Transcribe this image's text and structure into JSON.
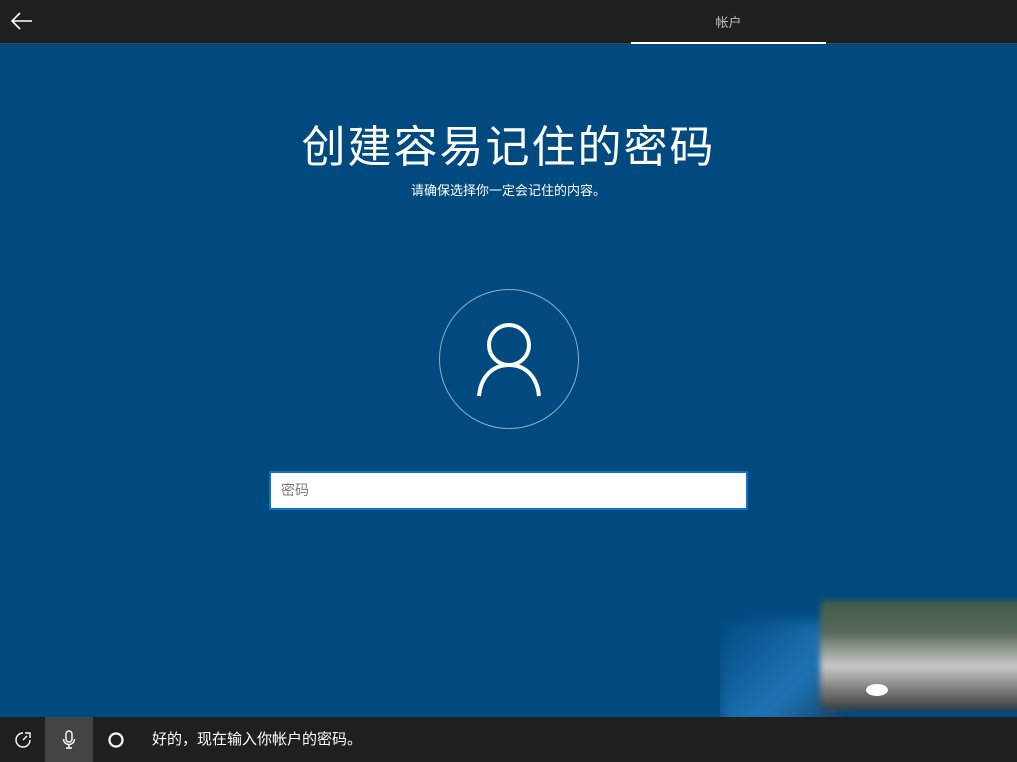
{
  "header": {
    "tab_label": "帐户"
  },
  "main": {
    "title": "创建容易记住的密码",
    "subtitle": "请确保选择你一定会记住的内容。",
    "password_placeholder": "密码",
    "password_value": ""
  },
  "bottom": {
    "cortana_message": "好的，现在输入你帐户的密码。"
  },
  "icons": {
    "back": "back-arrow-icon",
    "avatar": "user-icon",
    "ease": "ease-of-access-icon",
    "mic": "microphone-icon",
    "cortana": "cortana-icon"
  },
  "colors": {
    "background": "#004a7f",
    "bar": "#1f1f1f",
    "input_border": "#0a72c9"
  }
}
